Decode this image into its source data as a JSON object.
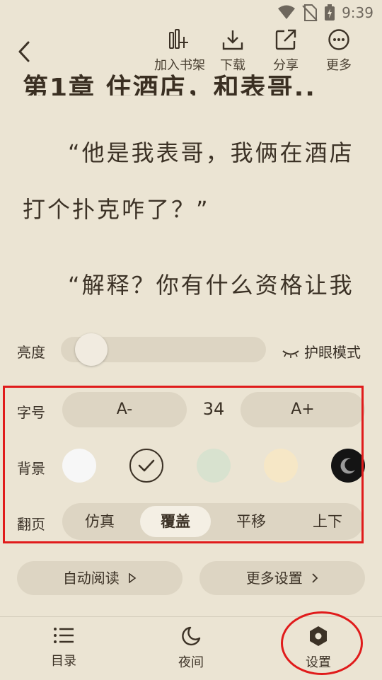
{
  "status_bar": {
    "time": "9:39"
  },
  "toolbar": {
    "add_shelf": "加入书架",
    "download": "下载",
    "share": "分享",
    "more": "更多"
  },
  "reading": {
    "partial_title": "第1章 住酒店，和表哥..",
    "line1": "“他是我表哥，我俩在酒店",
    "line2": "打个扑克咋了？”",
    "line3": "“解释？你有什么资格让我"
  },
  "settings": {
    "brightness_label": "亮度",
    "brightness_level": 0.08,
    "eye_mode": "护眼模式",
    "font_size_label": "字号",
    "font_decrease": "A-",
    "font_size_value": "34",
    "font_increase": "A+",
    "background_label": "背景",
    "backgrounds": [
      "#f7f7f7",
      "#ebe4d3",
      "#d8e2cf",
      "#f6e7c6",
      "#141414"
    ],
    "selected_background": 1,
    "page_turn_label": "翻页",
    "page_turn_options": [
      "仿真",
      "覆盖",
      "平移",
      "上下"
    ],
    "page_turn_selected": "覆盖",
    "auto_read": "自动阅读",
    "more_settings": "更多设置"
  },
  "bottom_nav": {
    "toc": "目录",
    "night": "夜间",
    "settings": "设置"
  },
  "colors": {
    "annotation": "#e01b1b",
    "background": "#ebe4d3"
  }
}
